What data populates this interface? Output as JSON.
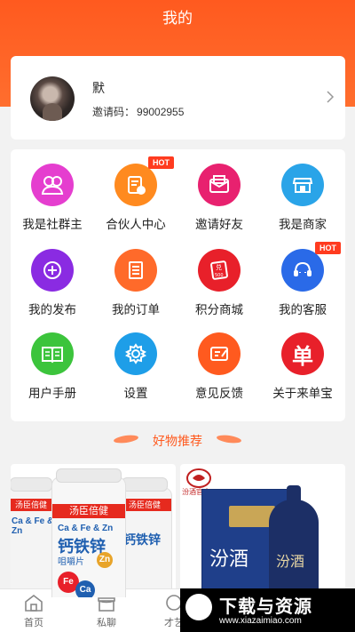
{
  "header": {
    "title": "我的",
    "bg_color": "#ff5a1f"
  },
  "profile": {
    "name": "默",
    "invite_label": "邀请码：",
    "invite_code": "99002955"
  },
  "grid": [
    {
      "label": "我是社群主",
      "icon": "community-icon",
      "color": "#e53ecf",
      "hot": false
    },
    {
      "label": "合伙人中心",
      "icon": "partner-icon",
      "color": "#ff8a1f",
      "hot": true
    },
    {
      "label": "邀请好友",
      "icon": "invite-icon",
      "color": "#e8216f",
      "hot": false
    },
    {
      "label": "我是商家",
      "icon": "shop-icon",
      "color": "#2aa4e8",
      "hot": false
    },
    {
      "label": "我的发布",
      "icon": "publish-icon",
      "color": "#8a2be2",
      "hot": false
    },
    {
      "label": "我的订单",
      "icon": "order-icon",
      "color": "#ff6a2a",
      "hot": false
    },
    {
      "label": "积分商城",
      "icon": "points-icon",
      "color": "#e8202a",
      "hot": false
    },
    {
      "label": "我的客服",
      "icon": "service-icon",
      "color": "#2a6ae8",
      "hot": true
    },
    {
      "label": "用户手册",
      "icon": "manual-icon",
      "color": "#3cc43c",
      "hot": false
    },
    {
      "label": "设置",
      "icon": "settings-icon",
      "color": "#1e9ee8",
      "hot": false
    },
    {
      "label": "意见反馈",
      "icon": "feedback-icon",
      "color": "#ff5a1f",
      "hot": false
    },
    {
      "label": "关于来单宝",
      "icon": "about-icon",
      "color": "#e8202a",
      "hot": false
    }
  ],
  "hot_label": "HOT",
  "section": {
    "title": "好物推荐"
  },
  "products": [
    {
      "brand": "汤臣倍健",
      "formula": "Ca & Fe & Zn",
      "name": "钙铁锌",
      "sub": "咀嚼片",
      "ball_fe": "Fe",
      "ball_zn": "Zn",
      "ball_ca": "Ca"
    },
    {
      "badge_text": "汾酒官方",
      "box_text": "汾酒",
      "bottle_text": "汾酒"
    }
  ],
  "tabs": [
    {
      "label": "首页",
      "icon": "home-icon"
    },
    {
      "label": "私聊",
      "icon": "chat-icon"
    },
    {
      "label": "才艺",
      "icon": "talent-icon"
    }
  ],
  "watermark": {
    "title": "下载与资源",
    "url": "www.xiazaimiao.com"
  }
}
